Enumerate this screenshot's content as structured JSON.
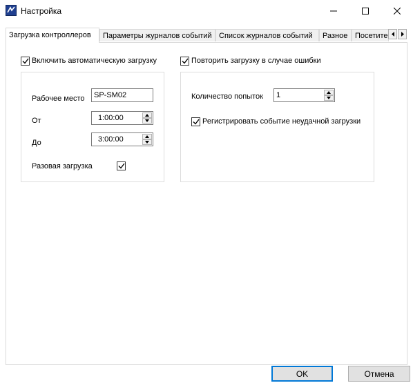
{
  "window": {
    "title": "Настройка",
    "minimize_glyph": "—",
    "maximize_glyph": "☐",
    "close_glyph": "✕"
  },
  "tabs": [
    {
      "label": "Загрузка контроллеров",
      "active": true
    },
    {
      "label": "Параметры журналов событий",
      "active": false
    },
    {
      "label": "Список журналов событий",
      "active": false
    },
    {
      "label": "Разное",
      "active": false
    },
    {
      "label": "Посетите",
      "active": false
    }
  ],
  "left": {
    "auto_load_label": "Включить автоматическую загрузку",
    "auto_load_checked": true,
    "workplace_label": "Рабочее место",
    "workplace_value": "SP-SM02",
    "from_label": "От",
    "from_value": "1:00:00",
    "to_label": "До",
    "to_value": "3:00:00",
    "one_time_label": "Разовая загрузка",
    "one_time_checked": true
  },
  "right": {
    "retry_label": "Повторить загрузку в случае ошибки",
    "retry_checked": true,
    "attempts_label": "Количество попыток",
    "attempts_value": "1",
    "log_failure_label": "Регистрировать событие неудачной загрузки",
    "log_failure_checked": true
  },
  "buttons": {
    "ok": "OK",
    "cancel": "Отмена"
  },
  "icons": {
    "app": "app-settings-icon",
    "check": "checkmark-icon",
    "up": "spin-up-icon",
    "down": "spin-down-icon"
  },
  "colors": {
    "accent": "#0078d7",
    "border": "#d9d9d9",
    "button_bg": "#e1e1e1"
  }
}
